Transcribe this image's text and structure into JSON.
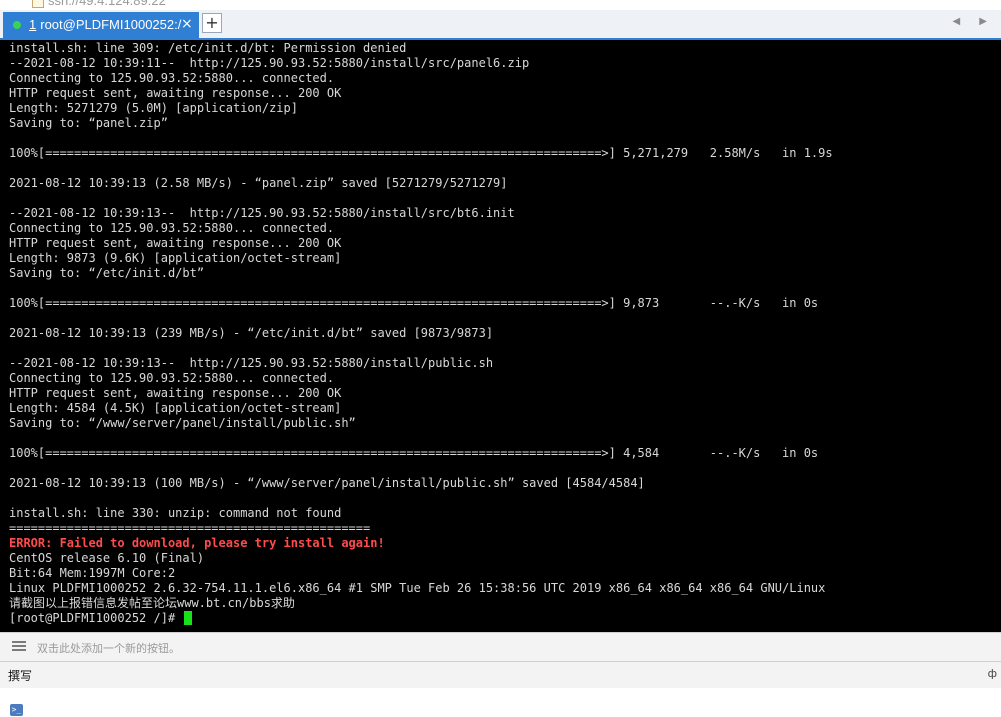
{
  "address_bar": {
    "text": "ssh://49.4.124.89:22"
  },
  "tab": {
    "number": "1",
    "title": "root@PLDFMI1000252:/",
    "close": "×"
  },
  "tab_add": "+",
  "tab_scroll": "◀ ▶",
  "terminal": {
    "lines": [
      "install.sh: line 309: /etc/init.d/bt: Permission denied",
      "--2021-08-12 10:39:11--  http://125.90.93.52:5880/install/src/panel6.zip",
      "Connecting to 125.90.93.52:5880... connected.",
      "HTTP request sent, awaiting response... 200 OK",
      "Length: 5271279 (5.0M) [application/zip]",
      "Saving to: “panel.zip”",
      "",
      "100%[=============================================================================>] 5,271,279   2.58M/s   in 1.9s",
      "",
      "2021-08-12 10:39:13 (2.58 MB/s) - “panel.zip” saved [5271279/5271279]",
      "",
      "--2021-08-12 10:39:13--  http://125.90.93.52:5880/install/src/bt6.init",
      "Connecting to 125.90.93.52:5880... connected.",
      "HTTP request sent, awaiting response... 200 OK",
      "Length: 9873 (9.6K) [application/octet-stream]",
      "Saving to: “/etc/init.d/bt”",
      "",
      "100%[=============================================================================>] 9,873       --.-K/s   in 0s",
      "",
      "2021-08-12 10:39:13 (239 MB/s) - “/etc/init.d/bt” saved [9873/9873]",
      "",
      "--2021-08-12 10:39:13--  http://125.90.93.52:5880/install/public.sh",
      "Connecting to 125.90.93.52:5880... connected.",
      "HTTP request sent, awaiting response... 200 OK",
      "Length: 4584 (4.5K) [application/octet-stream]",
      "Saving to: “/www/server/panel/install/public.sh”",
      "",
      "100%[=============================================================================>] 4,584       --.-K/s   in 0s",
      "",
      "2021-08-12 10:39:13 (100 MB/s) - “/www/server/panel/install/public.sh” saved [4584/4584]",
      "",
      "install.sh: line 330: unzip: command not found",
      "==================================================",
      "ERROR: Failed to download, please try install again!",
      "CentOS release 6.10 (Final)",
      "Bit:64 Mem:1997M Core:2",
      "Linux PLDFMI1000252 2.6.32-754.11.1.el6.x86_64 #1 SMP Tue Feb 26 15:38:56 UTC 2019 x86_64 x86_64 x86_64 GNU/Linux",
      "请截图以上报错信息发帖至论坛www.bt.cn/bbs求助",
      "[root@PLDFMI1000252 /]# "
    ],
    "error_line_index": 33,
    "colors": {
      "background": "#000000",
      "text": "#d8d8d8",
      "error": "#ff4b4b",
      "cursor": "#19e019"
    }
  },
  "quick_command_bar": {
    "hint": "双击此处添加一个新的按钮。"
  },
  "compose": {
    "title": "撰写",
    "pin": "ф"
  },
  "colors": {
    "tab_active": "#2f7fd4",
    "status_dot": "#39d353"
  }
}
